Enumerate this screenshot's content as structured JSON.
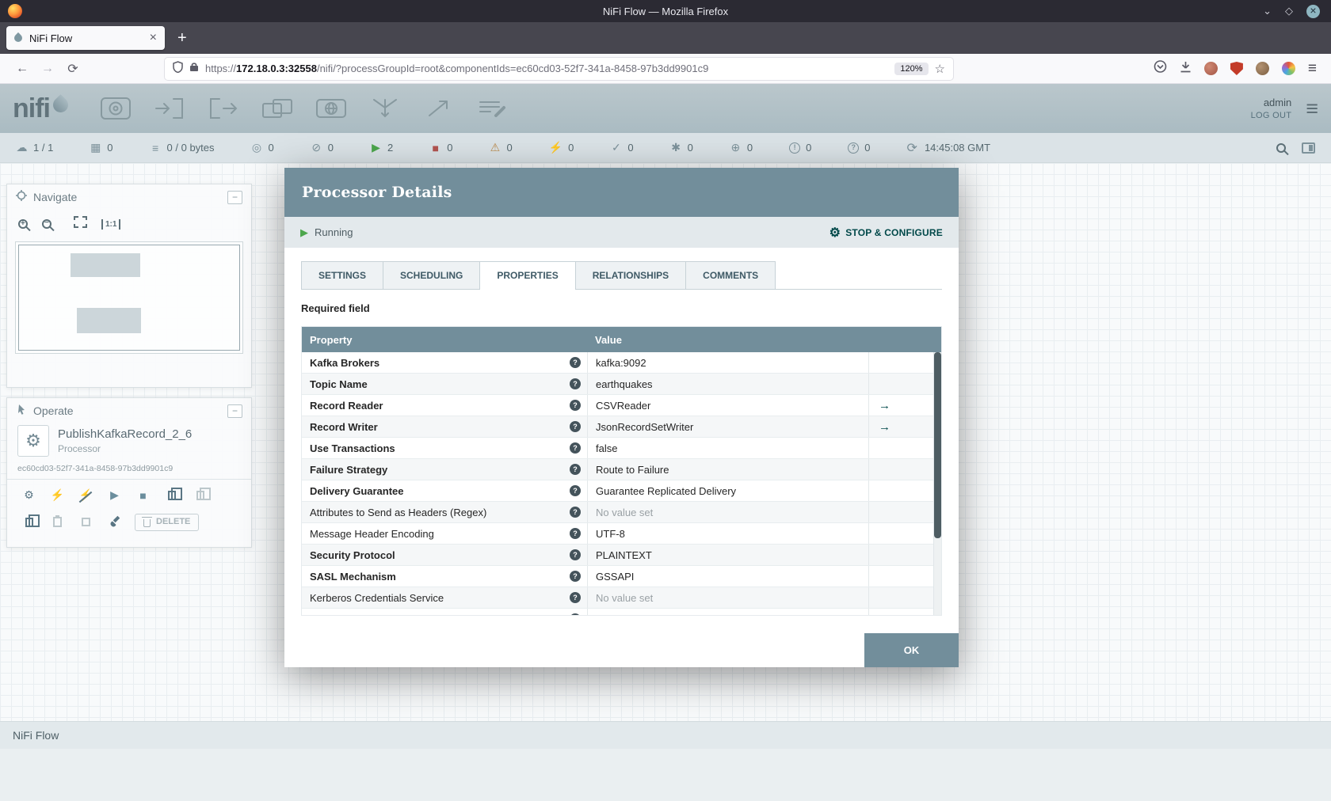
{
  "colors": {
    "dialog_header_bg": "#728e9b",
    "table_header_bg": "#728e9b",
    "accent_link": "#004849",
    "running_green": "#4ca64c",
    "stopped_red": "#b25450",
    "invalid_orange": "#bb8b4d",
    "titlebar_bg": "#2b2a33"
  },
  "titlebar": {
    "title": "NiFi Flow — Mozilla Firefox"
  },
  "browser": {
    "tab_title": "NiFi Flow",
    "tab_close": "×",
    "new_tab": "+",
    "url_scheme": "https://",
    "url_host": "172.18.0.3:32558",
    "url_path": "/nifi/?processGroupId=root&componentIds=ec60cd03-52f7-341a-8458-97b3dd9901c9",
    "zoom_level": "120%"
  },
  "app_header": {
    "logo_text": "nifi",
    "toolbar_icons": [
      "processor",
      "input-port",
      "output-port",
      "process-group",
      "remote-process-group",
      "funnel",
      "template",
      "label"
    ],
    "user": "admin",
    "logout": "LOG OUT"
  },
  "status_bar": {
    "items": [
      {
        "name": "connected-nodes-icon",
        "glyph": "☁",
        "value": "1 / 1"
      },
      {
        "name": "active-threads-icon",
        "glyph": "▦",
        "value": "0"
      },
      {
        "name": "queued-icon",
        "glyph": "≡",
        "value": "0 / 0 bytes"
      },
      {
        "name": "transmitting-icon",
        "glyph": "◎",
        "value": "0"
      },
      {
        "name": "not-transmitting-icon",
        "glyph": "⊘",
        "value": "0"
      },
      {
        "name": "running-icon",
        "glyph": "▶",
        "value": "2",
        "color": "#4ca64c"
      },
      {
        "name": "stopped-icon",
        "glyph": "■",
        "value": "0",
        "color": "#b25450"
      },
      {
        "name": "invalid-icon",
        "glyph": "⚠",
        "value": "0",
        "color": "#bb8b4d"
      },
      {
        "name": "disabled-icon",
        "glyph": "⚡",
        "value": "0"
      },
      {
        "name": "up-to-date-icon",
        "glyph": "✓",
        "value": "0"
      },
      {
        "name": "locally-modified-icon",
        "glyph": "✱",
        "value": "0"
      },
      {
        "name": "stale-icon",
        "glyph": "⊕",
        "value": "0"
      },
      {
        "name": "locally-modified-stale-icon",
        "glyph": "!",
        "value": "0",
        "circled": true
      },
      {
        "name": "sync-failure-icon",
        "glyph": "?",
        "value": "0",
        "circled": true
      }
    ],
    "refreshed": "14:45:08 GMT"
  },
  "navigate_panel": {
    "title": "Navigate",
    "collapse": "−",
    "actual_size": "1:1"
  },
  "operate_panel": {
    "title": "Operate",
    "collapse": "−",
    "component_name": "PublishKafkaRecord_2_6",
    "component_type": "Processor",
    "component_id": "ec60cd03-52f7-341a-8458-97b3dd9901c9",
    "delete_label": "DELETE"
  },
  "dialog": {
    "title": "Processor Details",
    "status_label": "Running",
    "action_label": "STOP & CONFIGURE",
    "tabs": [
      {
        "name": "tab-settings",
        "label": "SETTINGS"
      },
      {
        "name": "tab-scheduling",
        "label": "SCHEDULING"
      },
      {
        "name": "tab-properties",
        "label": "PROPERTIES",
        "active": true
      },
      {
        "name": "tab-relationships",
        "label": "RELATIONSHIPS"
      },
      {
        "name": "tab-comments",
        "label": "COMMENTS"
      }
    ],
    "required_note": "Required field",
    "table": {
      "property_header": "Property",
      "value_header": "Value",
      "rows": [
        {
          "property": "Kafka Brokers",
          "required": true,
          "value": "kafka:9092"
        },
        {
          "property": "Topic Name",
          "required": true,
          "value": "earthquakes"
        },
        {
          "property": "Record Reader",
          "required": true,
          "value": "CSVReader",
          "goto": true
        },
        {
          "property": "Record Writer",
          "required": true,
          "value": "JsonRecordSetWriter",
          "goto": true
        },
        {
          "property": "Use Transactions",
          "required": true,
          "value": "false"
        },
        {
          "property": "Failure Strategy",
          "required": true,
          "value": "Route to Failure"
        },
        {
          "property": "Delivery Guarantee",
          "required": true,
          "value": "Guarantee Replicated Delivery"
        },
        {
          "property": "Attributes to Send as Headers (Regex)",
          "value": "No value set",
          "no_value": true
        },
        {
          "property": "Message Header Encoding",
          "value": "UTF-8"
        },
        {
          "property": "Security Protocol",
          "required": true,
          "value": "PLAINTEXT"
        },
        {
          "property": "SASL Mechanism",
          "required": true,
          "value": "GSSAPI"
        },
        {
          "property": "Kerberos Credentials Service",
          "value": "No value set",
          "no_value": true
        },
        {
          "property": "",
          "value": "",
          "partial": true
        }
      ]
    },
    "ok_label": "OK"
  },
  "footer": {
    "breadcrumb": "NiFi Flow"
  }
}
